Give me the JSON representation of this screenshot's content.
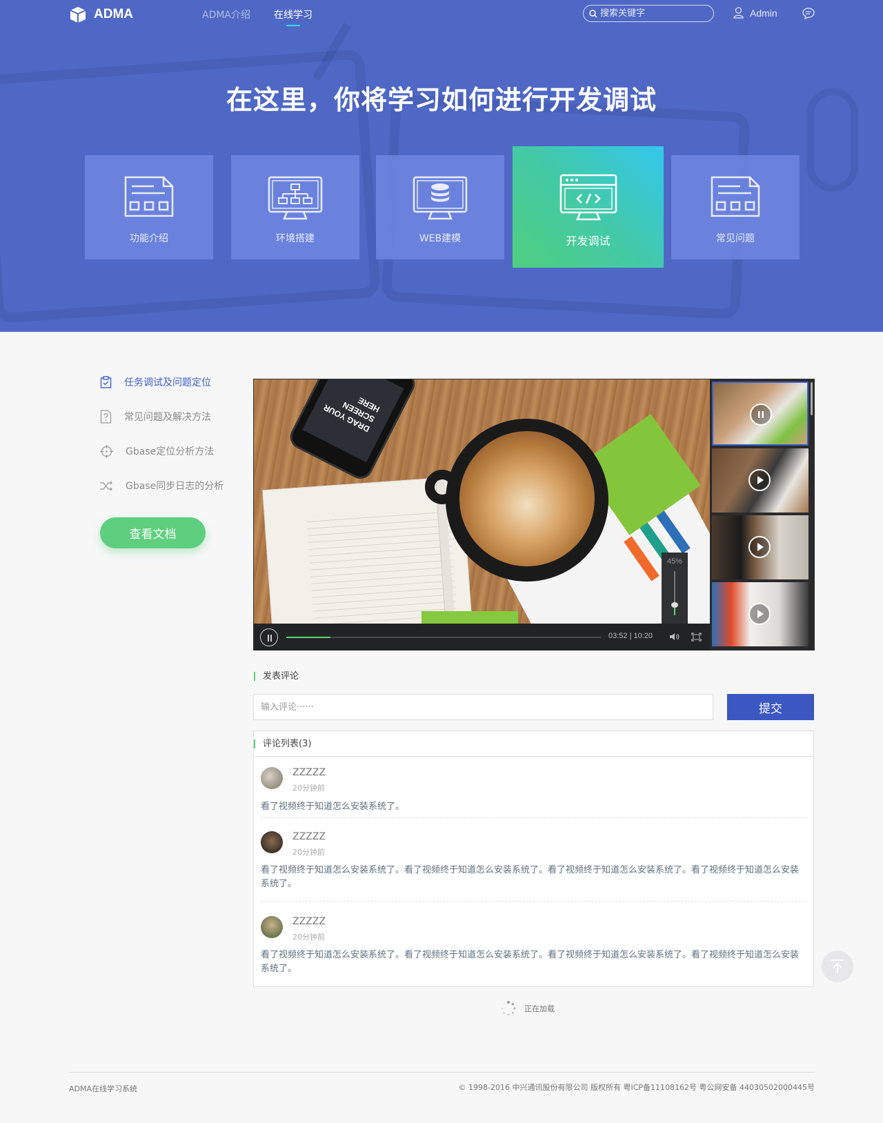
{
  "header": {
    "logo_text": "ADMA",
    "nav": [
      {
        "label": "ADMA介绍"
      },
      {
        "label": "在线学习"
      }
    ],
    "search_placeholder": "搜索关键字",
    "user_name": "Admin",
    "accent_color": "#4f68c5"
  },
  "hero": {
    "title": "在这里，你将学习如何进行开发调试",
    "categories": [
      {
        "label": "功能介绍",
        "icon": "document-icon"
      },
      {
        "label": "环境搭建",
        "icon": "network-monitor-icon"
      },
      {
        "label": "WEB建模",
        "icon": "database-monitor-icon"
      },
      {
        "label": "开发调试",
        "icon": "code-monitor-icon",
        "active": true
      },
      {
        "label": "常见问题",
        "icon": "document-icon"
      }
    ]
  },
  "sidebar": {
    "items": [
      {
        "label": "任务调试及问题定位",
        "icon": "clipboard-check-icon",
        "active": true
      },
      {
        "label": "常见问题及解决方法",
        "icon": "question-doc-icon"
      },
      {
        "label": "Gbase定位分析方法",
        "icon": "crosshair-icon"
      },
      {
        "label": "Gbase同步日志的分析",
        "icon": "shuffle-icon"
      }
    ],
    "doc_button": "查看文档"
  },
  "player": {
    "phone_text": "DRAG YOUR SCREEN HERE",
    "volume_label": "45%",
    "volume": 0.45,
    "progress": 0.14,
    "current_time": "03:52",
    "duration": "10:20",
    "playlist_count": 4
  },
  "comments": {
    "post_title": "发表评论",
    "input_placeholder": "输入评论······",
    "submit_label": "提交",
    "list_title": "评论列表(3)",
    "items": [
      {
        "name": "ZZZZZ",
        "time": "20分钟前",
        "text": "看了视频终于知道怎么安装系统了。"
      },
      {
        "name": "ZZZZZ",
        "time": "20分钟前",
        "text": "看了视频终于知道怎么安装系统了。看了视频终于知道怎么安装系统了。看了视频终于知道怎么安装系统了。看了视频终于知道怎么安装系统了。"
      },
      {
        "name": "ZZZZZ",
        "time": "20分钟前",
        "text": "看了视频终于知道怎么安装系统了。看了视频终于知道怎么安装系统了。看了视频终于知道怎么安装系统了。看了视频终于知道怎么安装系统了。"
      }
    ],
    "loading_text": "正在加载"
  },
  "footer": {
    "left": "ADMA在线学习系统",
    "right": "© 1998-2016 中兴通讯股份有限公司 版权所有   粤ICP备11108162号  粤公网安备 44030502000445号"
  }
}
